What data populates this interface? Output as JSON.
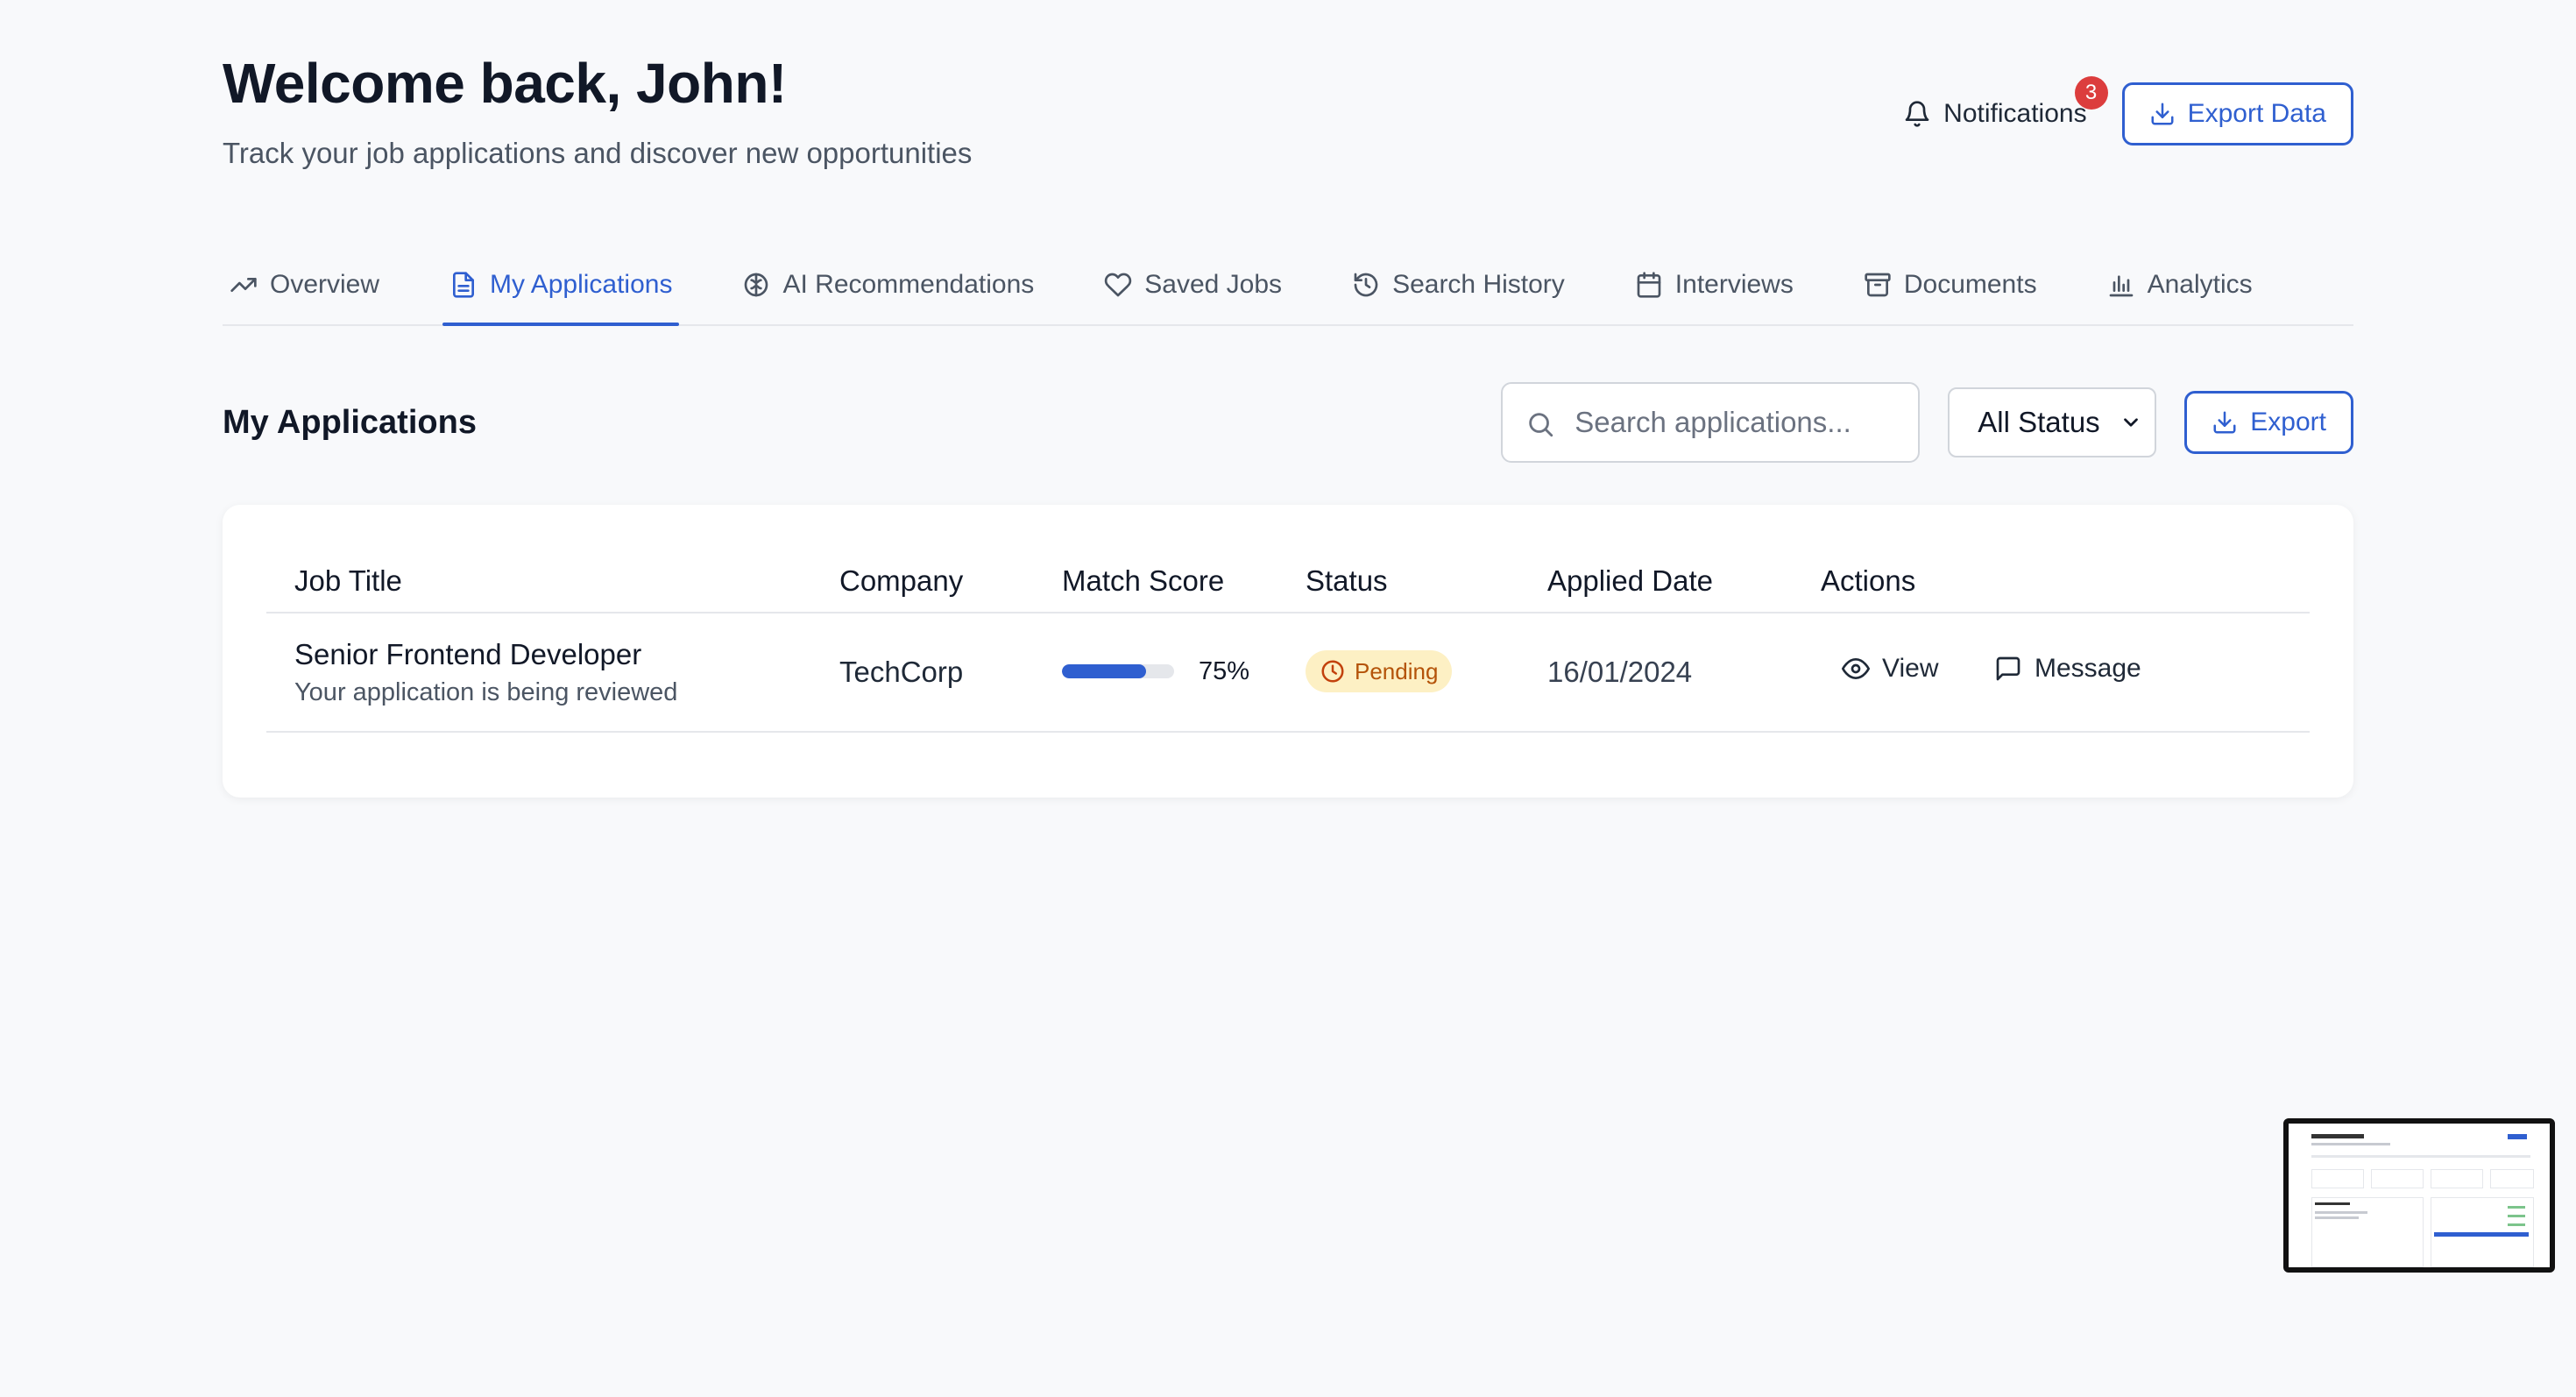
{
  "header": {
    "title": "Welcome back, John!",
    "subtitle": "Track your job applications and discover new opportunities",
    "notifications_label": "Notifications",
    "notifications_count": "3",
    "export_data_label": "Export Data"
  },
  "tabs": [
    {
      "label": "Overview",
      "icon": "trending-up-icon"
    },
    {
      "label": "My Applications",
      "icon": "file-text-icon",
      "active": true
    },
    {
      "label": "AI Recommendations",
      "icon": "brain-icon"
    },
    {
      "label": "Saved Jobs",
      "icon": "heart-icon"
    },
    {
      "label": "Search History",
      "icon": "history-icon"
    },
    {
      "label": "Interviews",
      "icon": "calendar-icon"
    },
    {
      "label": "Documents",
      "icon": "archive-icon"
    },
    {
      "label": "Analytics",
      "icon": "bar-chart-icon"
    }
  ],
  "applications": {
    "title": "My Applications",
    "search_placeholder": "Search applications...",
    "status_filter": "All Status",
    "export_label": "Export",
    "columns": [
      "Job Title",
      "Company",
      "Match Score",
      "Status",
      "Applied Date",
      "Actions"
    ],
    "rows": [
      {
        "job_title": "Senior Frontend Developer",
        "job_subtitle": "Your application is being reviewed",
        "company": "TechCorp",
        "match_score": 75,
        "match_score_label": "75%",
        "status": "Pending",
        "applied_date": "16/01/2024",
        "view_label": "View",
        "message_label": "Message"
      }
    ]
  },
  "colors": {
    "accent": "#2f5fd0",
    "badge": "#dc3d3d",
    "pending_bg": "#fdf0c4",
    "pending_text": "#b45309",
    "background": "#f8f9fb"
  }
}
